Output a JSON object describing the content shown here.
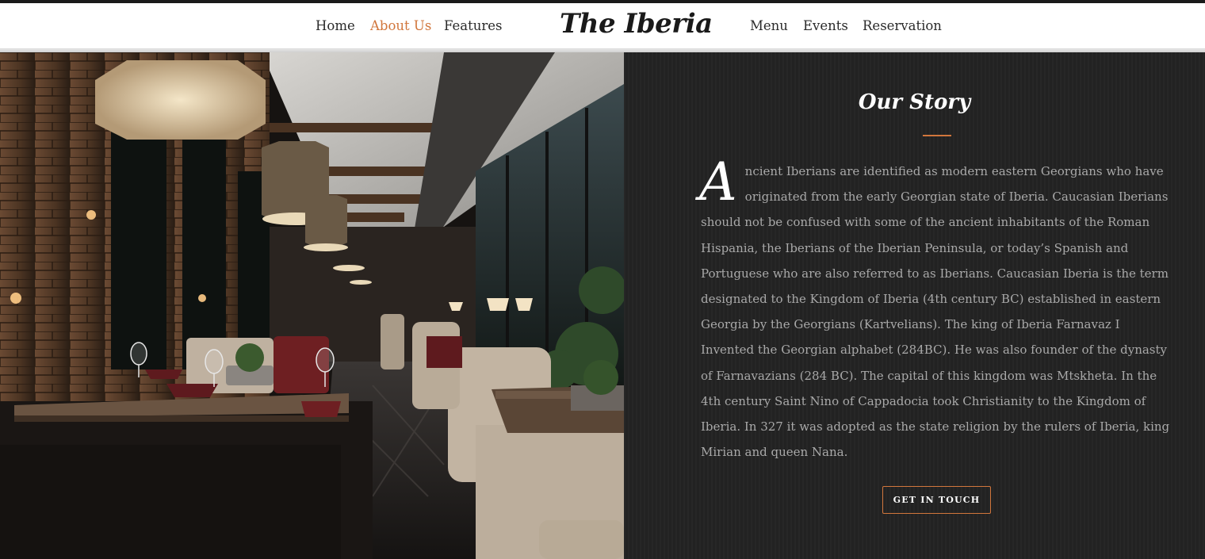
{
  "nav": {
    "left_items": [
      {
        "label": "Home",
        "active": false
      },
      {
        "label": "About Us",
        "active": true
      },
      {
        "label": "Features",
        "active": false
      }
    ],
    "logo": "The Iberia",
    "right_items": [
      {
        "label": "Menu",
        "active": false
      },
      {
        "label": "Events",
        "active": false
      },
      {
        "label": "Reservation",
        "active": false
      }
    ]
  },
  "hero_image": {
    "description_icon": "restaurant-interior-photo"
  },
  "story": {
    "title": "Our Story",
    "drop_cap": "A",
    "body": "ncient Iberians are identified as modern eastern Georgians who have originated from the early Georgian state of Iberia. Caucasian Iberians should not be confused with some of the ancient inhabitants of the Roman Hispania, the Iberians of the Iberian Peninsula, or today’s Spanish and Portuguese who are also referred to as Iberians. Caucasian Iberia is the term designated to the Kingdom of Iberia (4th century BC) established in eastern Georgia by the Georgians (Kartvelians). The king of Iberia Farnavaz I Invented the Georgian alphabet (284BC). He was also founder of the dynasty of Farnavazians (284 BC). The capital of this kingdom was Mtskheta. In the 4th century Saint Nino of Cappadocia took Christianity to the Kingdom of Iberia. In 327 it was adopted as the state religion by the rulers of Iberia, king Mirian and queen Nana.",
    "button_label": "GET IN TOUCH"
  },
  "colors": {
    "accent": "#d1763c",
    "panel_bg": "#232323",
    "body_text": "#a9a9a9",
    "nav_bg": "#ffffff"
  }
}
